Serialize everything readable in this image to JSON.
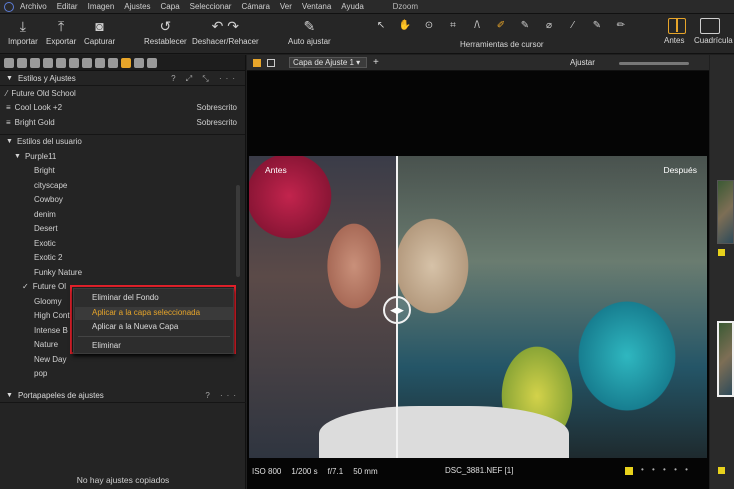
{
  "menubar": {
    "items": [
      "Archivo",
      "Editar",
      "Imagen",
      "Ajustes",
      "Capa",
      "Seleccionar",
      "Cámara",
      "Ver",
      "Ventana",
      "Ayuda"
    ],
    "window_title": "Dzoom"
  },
  "toolbar": {
    "import": "Importar",
    "export": "Exportar",
    "capture": "Capturar",
    "reset": "Restablecer",
    "undo_redo": "Deshacer/Rehacer",
    "auto_adjust": "Auto ajustar",
    "cursor_tools": "Herramientas de cursor",
    "before": "Antes",
    "quad": "Cuadrícula"
  },
  "styles_panel": {
    "title": "Estilos y Ajustes",
    "actions": "? ⤢ ⤡ ···",
    "applied": [
      {
        "name": "Future Old School",
        "status": "",
        "icon": "brush-icon"
      },
      {
        "name": "Cool Look +2",
        "status": "Sobrescrito",
        "icon": "stack-icon"
      },
      {
        "name": "Bright Gold",
        "status": "Sobrescrito",
        "icon": "stack-icon"
      }
    ],
    "user_styles_label": "Estilos del usuario",
    "group_label": "Purple11",
    "styles": [
      "Bright",
      "cityscape",
      "Cowboy",
      "denim",
      "Desert",
      "Exotic",
      "Exotic 2",
      "Funky Nature",
      "Future Ol",
      "Gloomy",
      "High Cont",
      "Intense B",
      "Nature",
      "New Day",
      "pop"
    ]
  },
  "context_menu": {
    "items": [
      "Eliminar del Fondo",
      "Aplicar a la capa seleccionada",
      "Aplicar a la Nueva Capa",
      "Eliminar"
    ],
    "highlighted_index": 1
  },
  "clipboard_panel": {
    "title": "Portapapeles de ajustes",
    "actions": "? ···",
    "empty_text": "No hay ajustes copiados"
  },
  "viewer": {
    "layer_select": "Capa de Ajuste 1 ▾",
    "adjust_label": "Ajustar",
    "label_before": "Antes",
    "label_after": "Después",
    "info": {
      "iso": "ISO 800",
      "shutter": "1/200 s",
      "aperture": "f/7.1",
      "focal": "50 mm",
      "file": "DSC_3881.NEF [1]"
    }
  },
  "colors": {
    "accent": "#e7a52a",
    "highlight_outline": "#e3212b",
    "rating": "#e8d21c"
  }
}
